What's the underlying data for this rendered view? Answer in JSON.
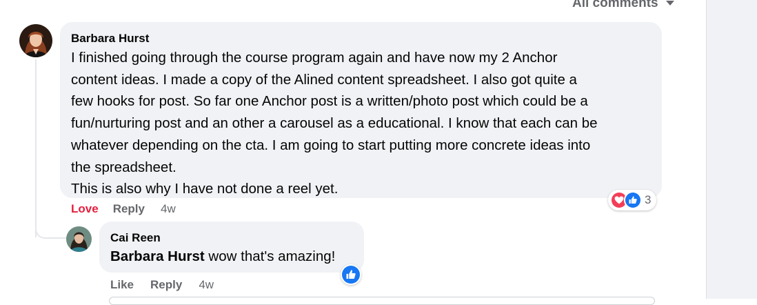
{
  "sort": {
    "label": "All comments"
  },
  "comments": [
    {
      "author": "Barbara Hurst",
      "text": "I finished going through the course program again and have now my 2 Anchor\ncontent ideas. I made a copy of the Alined content spreadsheet. I also got quite a\nfew hooks for post. So far one Anchor post is a written/photo post which could be a\nfun/nurturing post and an other a carousel as a educational. I know that each can be\nwhatever depending on the cta. I am going to start putting more concrete ideas into\nthe spreadsheet.\nThis is also why I have not done a reel yet.",
      "reaction_label": "Love",
      "reply_label": "Reply",
      "time": "4w",
      "reactions": {
        "count": "3",
        "icons": [
          "heart-icon",
          "like-icon"
        ]
      }
    },
    {
      "author": "Cai Reen",
      "mention": "Barbara Hurst",
      "text": " wow that's amazing!",
      "reaction_label": "Like",
      "reply_label": "Reply",
      "time": "4w",
      "reactions": {
        "icons": [
          "like-icon"
        ]
      }
    }
  ],
  "colors": {
    "bubble": "#f0f2f5",
    "love": "#e41e3f",
    "like": "#1877f2",
    "secondary_text": "#65676b"
  }
}
